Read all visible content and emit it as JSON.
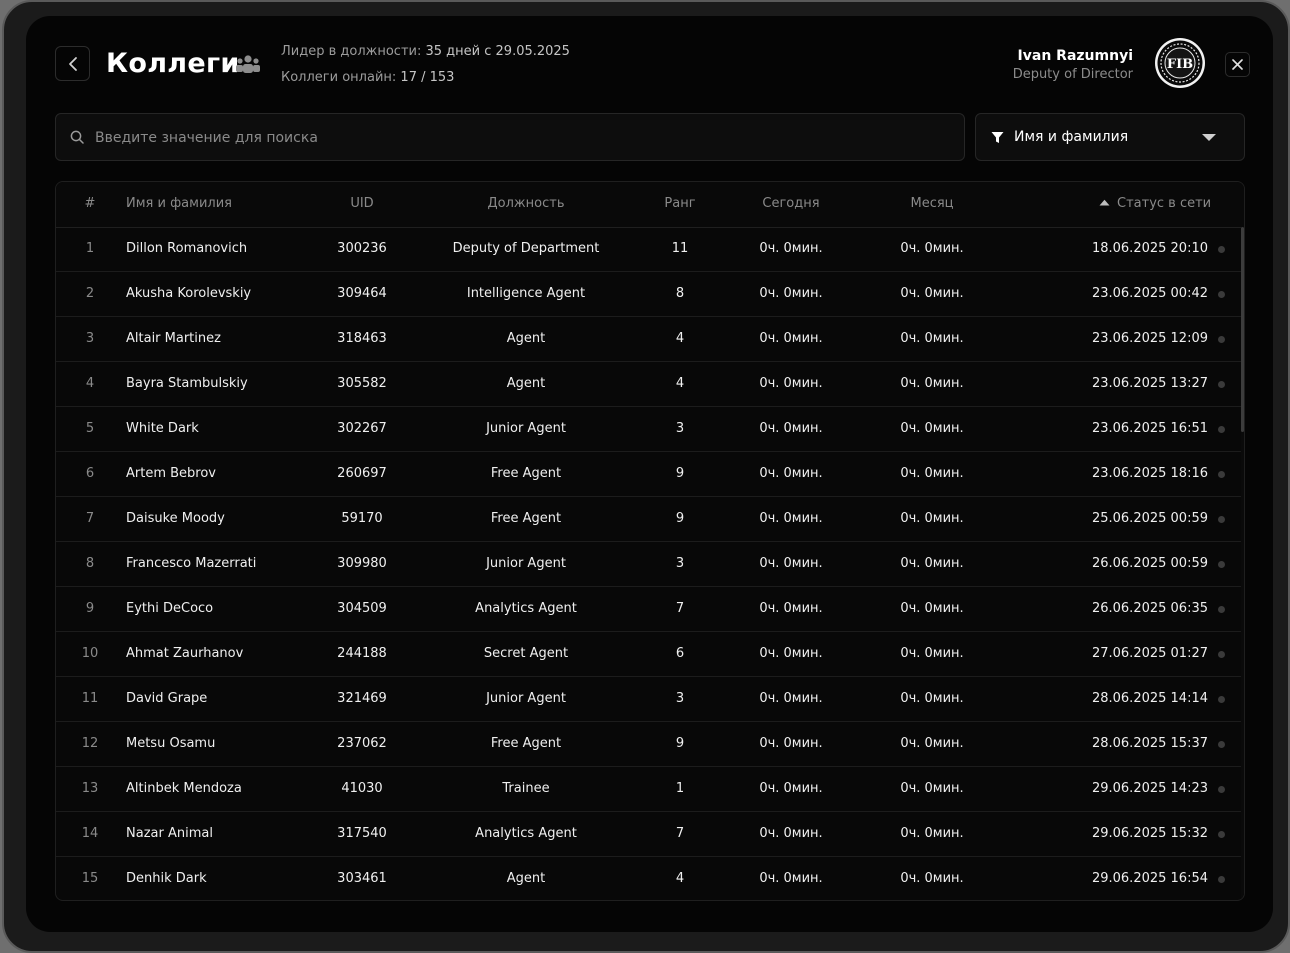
{
  "header": {
    "title": "Коллеги",
    "leader_label": "Лидер в должности:",
    "leader_value": "35 дней  с 29.05.2025",
    "online_label": "Коллеги онлайн:",
    "online_value": "17 / 153"
  },
  "user": {
    "name": "Ivan Razumnyi",
    "role": "Deputy of Director",
    "avatar_text": "FIB"
  },
  "search": {
    "placeholder": "Введите значение для поиска",
    "value": ""
  },
  "filter": {
    "selected": "Имя и фамилия"
  },
  "table": {
    "columns": {
      "num": "#",
      "name": "Имя и фамилия",
      "uid": "UID",
      "position": "Должность",
      "rank": "Ранг",
      "today": "Сегодня",
      "month": "Месяц",
      "status": "Статус в сети"
    },
    "rows": [
      {
        "num": "1",
        "name": "Dillon Romanovich",
        "uid": "300236",
        "position": "Deputy of Department",
        "rank": "11",
        "today": "0ч. 0мин.",
        "month": "0ч. 0мин.",
        "status": "18.06.2025 20:10"
      },
      {
        "num": "2",
        "name": "Akusha Korolevskiy",
        "uid": "309464",
        "position": "Intelligence Agent",
        "rank": "8",
        "today": "0ч. 0мин.",
        "month": "0ч. 0мин.",
        "status": "23.06.2025 00:42"
      },
      {
        "num": "3",
        "name": "Altair Martinez",
        "uid": "318463",
        "position": "Agent",
        "rank": "4",
        "today": "0ч. 0мин.",
        "month": "0ч. 0мин.",
        "status": "23.06.2025 12:09"
      },
      {
        "num": "4",
        "name": "Bayra Stambulskiy",
        "uid": "305582",
        "position": "Agent",
        "rank": "4",
        "today": "0ч. 0мин.",
        "month": "0ч. 0мин.",
        "status": "23.06.2025 13:27"
      },
      {
        "num": "5",
        "name": "White Dark",
        "uid": "302267",
        "position": "Junior Agent",
        "rank": "3",
        "today": "0ч. 0мин.",
        "month": "0ч. 0мин.",
        "status": "23.06.2025 16:51"
      },
      {
        "num": "6",
        "name": "Artem Bebrov",
        "uid": "260697",
        "position": "Free Agent",
        "rank": "9",
        "today": "0ч. 0мин.",
        "month": "0ч. 0мин.",
        "status": "23.06.2025 18:16"
      },
      {
        "num": "7",
        "name": "Daisuke Moody",
        "uid": "59170",
        "position": "Free Agent",
        "rank": "9",
        "today": "0ч. 0мин.",
        "month": "0ч. 0мин.",
        "status": "25.06.2025 00:59"
      },
      {
        "num": "8",
        "name": "Francesco Mazerrati",
        "uid": "309980",
        "position": "Junior Agent",
        "rank": "3",
        "today": "0ч. 0мин.",
        "month": "0ч. 0мин.",
        "status": "26.06.2025 00:59"
      },
      {
        "num": "9",
        "name": "Eythi DeCoco",
        "uid": "304509",
        "position": "Analytics Agent",
        "rank": "7",
        "today": "0ч. 0мин.",
        "month": "0ч. 0мин.",
        "status": "26.06.2025 06:35"
      },
      {
        "num": "10",
        "name": "Ahmat Zaurhanov",
        "uid": "244188",
        "position": "Secret Agent",
        "rank": "6",
        "today": "0ч. 0мин.",
        "month": "0ч. 0мин.",
        "status": "27.06.2025 01:27"
      },
      {
        "num": "11",
        "name": "David Grape",
        "uid": "321469",
        "position": "Junior Agent",
        "rank": "3",
        "today": "0ч. 0мин.",
        "month": "0ч. 0мин.",
        "status": "28.06.2025 14:14"
      },
      {
        "num": "12",
        "name": "Metsu Osamu",
        "uid": "237062",
        "position": "Free Agent",
        "rank": "9",
        "today": "0ч. 0мин.",
        "month": "0ч. 0мин.",
        "status": "28.06.2025 15:37"
      },
      {
        "num": "13",
        "name": "Altinbek Mendoza",
        "uid": "41030",
        "position": "Trainee",
        "rank": "1",
        "today": "0ч. 0мин.",
        "month": "0ч. 0мин.",
        "status": "29.06.2025 14:23"
      },
      {
        "num": "14",
        "name": "Nazar Animal",
        "uid": "317540",
        "position": "Analytics Agent",
        "rank": "7",
        "today": "0ч. 0мин.",
        "month": "0ч. 0мин.",
        "status": "29.06.2025 15:32"
      },
      {
        "num": "15",
        "name": "Denhik Dark",
        "uid": "303461",
        "position": "Agent",
        "rank": "4",
        "today": "0ч. 0мин.",
        "month": "0ч. 0мин.",
        "status": "29.06.2025 16:54"
      }
    ]
  }
}
